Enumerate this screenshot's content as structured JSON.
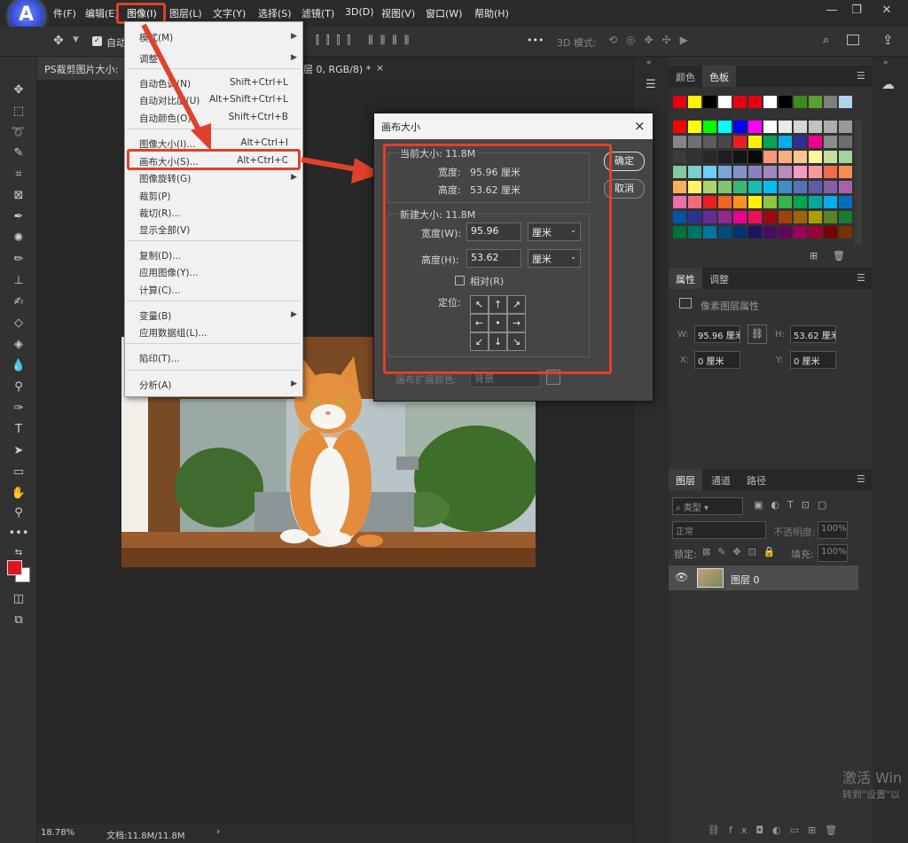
{
  "menubar": {
    "items": [
      "件(F)",
      "编辑(E)",
      "图像(I)",
      "图层(L)",
      "文字(Y)",
      "选择(S)",
      "滤镜(T)",
      "3D(D)",
      "视图(V)",
      "窗口(W)",
      "帮助(H)"
    ],
    "logo_letter": "A"
  },
  "optbar": {
    "auto_label": "自动",
    "mode3d": "3D 模式:",
    "more": "•••"
  },
  "doc_tab": {
    "label_left": "PS裁剪图片大小:",
    "label_right": "层 0, RGB/8) *",
    "close": "×"
  },
  "status": {
    "zoom": "18.78%",
    "doc": "文档:11.8M/11.8M",
    "arrow": "›"
  },
  "image_menu": {
    "items": [
      {
        "label": "模式(M)",
        "shortcut": "",
        "submenu": true
      },
      {
        "label": "调整",
        "shortcut": "",
        "submenu": true
      },
      {
        "label": "自动色调(N)",
        "shortcut": "Shift+Ctrl+L",
        "submenu": false
      },
      {
        "label": "自动对比度(U)",
        "shortcut": "Alt+Shift+Ctrl+L",
        "submenu": false
      },
      {
        "label": "自动颜色(O)",
        "shortcut": "Shift+Ctrl+B",
        "submenu": false
      },
      {
        "label": "图像大小(I)...",
        "shortcut": "Alt+Ctrl+I",
        "submenu": false
      },
      {
        "label": "画布大小(S)...",
        "shortcut": "Alt+Ctrl+C",
        "submenu": false
      },
      {
        "label": "图像旋转(G)",
        "shortcut": "",
        "submenu": true
      },
      {
        "label": "裁剪(P)",
        "shortcut": "",
        "submenu": false
      },
      {
        "label": "裁切(R)...",
        "shortcut": "",
        "submenu": false
      },
      {
        "label": "显示全部(V)",
        "shortcut": "",
        "submenu": false
      },
      {
        "label": "复制(D)...",
        "shortcut": "",
        "submenu": false
      },
      {
        "label": "应用图像(Y)...",
        "shortcut": "",
        "submenu": false
      },
      {
        "label": "计算(C)...",
        "shortcut": "",
        "submenu": false
      },
      {
        "label": "变量(B)",
        "shortcut": "",
        "submenu": true
      },
      {
        "label": "应用数据组(L)...",
        "shortcut": "",
        "submenu": false
      },
      {
        "label": "陷印(T)...",
        "shortcut": "",
        "submenu": false
      },
      {
        "label": "分析(A)",
        "shortcut": "",
        "submenu": true
      }
    ]
  },
  "dialog": {
    "title": "画布大小",
    "close": "×",
    "current_size": "当前大小: 11.8M",
    "cur_width_label": "宽度:",
    "cur_width_value": "95.96 厘米",
    "cur_height_label": "高度:",
    "cur_height_value": "53.62 厘米",
    "new_size": "新建大小: 11.8M",
    "width_label": "宽度(W):",
    "width_value": "95.96",
    "height_label": "高度(H):",
    "height_value": "53.62",
    "unit": "厘米",
    "relative": "相对(R)",
    "anchor_label": "定位:",
    "ext_color_label": "画布扩展颜色:",
    "ext_color_value": "背景",
    "ok": "确定",
    "cancel": "取消"
  },
  "panels": {
    "color_tabs": [
      "颜色",
      "色板"
    ],
    "props_tabs": [
      "属性",
      "调整"
    ],
    "props_title": "像素图层属性",
    "w_label": "W:",
    "w_value": "95.96 厘米",
    "h_label": "H:",
    "h_value": "53.62 厘米",
    "x_label": "X:",
    "x_value": "0 厘米",
    "y_label": "Y:",
    "y_value": "0 厘米",
    "layers_tabs": [
      "图层",
      "通道",
      "路径"
    ],
    "filter_label": "类型",
    "blend_mode": "正常",
    "opacity_label": "不透明度:",
    "opacity_value": "100%",
    "lock_label": "锁定:",
    "fill_label": "填充:",
    "fill_value": "100%",
    "layer_name": "图层 0",
    "bottom_icons": "fx"
  },
  "watermark": {
    "line1": "激活 Win",
    "line2": "转到\"设置\"以"
  },
  "colors": {
    "accent_red": "#e0412a",
    "fg_color": "#e0141e",
    "bg_color": "#ffffff"
  }
}
